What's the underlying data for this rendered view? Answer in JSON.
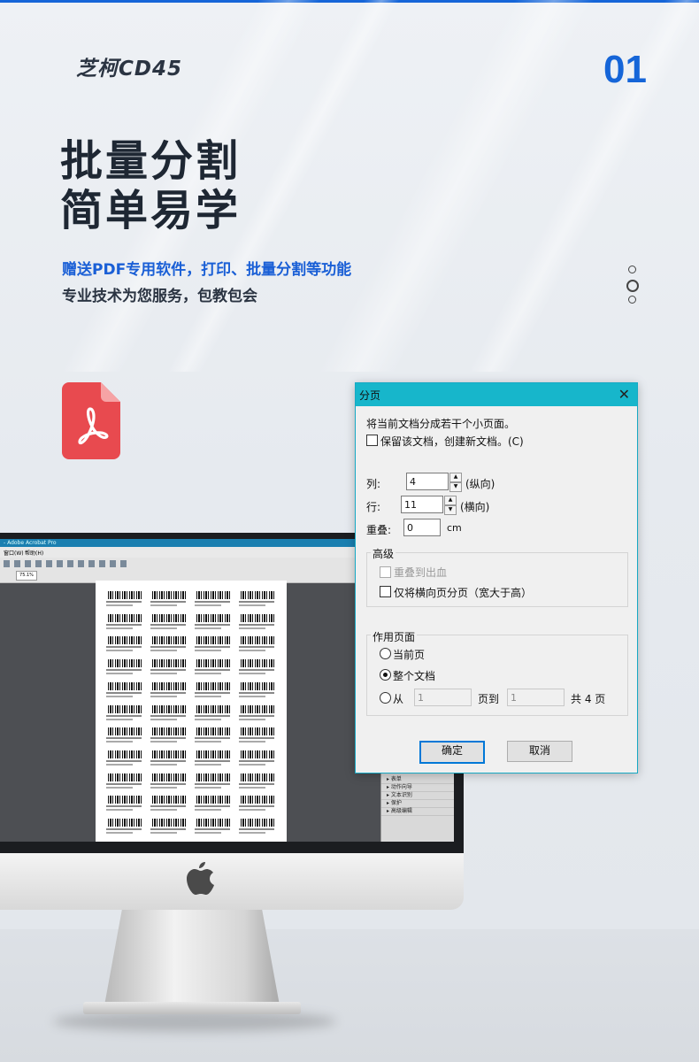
{
  "brand": "芝柯CD45",
  "page_number": "01",
  "headline": {
    "line1": "批量分割",
    "line2": "简单易学"
  },
  "subtitle": {
    "line1": "赠送PDF专用软件，打印、批量分割等功能",
    "line2": "专业技术为您服务，包教包会"
  },
  "pager": {
    "total": 3,
    "active_index": 1
  },
  "app_window": {
    "title": "- Adobe Acrobat Pro",
    "menu_items": [
      "窗口(W)",
      "帮助(H)"
    ],
    "zoom": "75.1%",
    "side_panel_items": [
      "表单",
      "动作向导",
      "文本识别",
      "保护",
      "高级编辑"
    ]
  },
  "dialog": {
    "title": "分页",
    "close_symbol": "✕",
    "description": "将当前文档分成若干个小页面。",
    "keep_doc_label": "保留该文档，创建新文档。(C)",
    "keep_doc_checked": false,
    "columns": {
      "label": "列:",
      "value": "4",
      "hint": "(纵向)"
    },
    "rows": {
      "label": "行:",
      "value": "11",
      "hint": "(横向)"
    },
    "overlap": {
      "label": "重叠:",
      "value": "0",
      "unit": "cm"
    },
    "spin_up": "▲",
    "spin_down": "▼",
    "advanced": {
      "title": "高级",
      "bleed_label": "重叠到出血",
      "bleed_checked": false,
      "bleed_disabled": true,
      "landscape_label": "仅将横向页分页（宽大于高）",
      "landscape_checked": false
    },
    "page_range": {
      "title": "作用页面",
      "current_label": "当前页",
      "whole_label": "整个文档",
      "selected": "whole",
      "from_label": "从",
      "from_value": "1",
      "to_label": "页到",
      "to_value": "1",
      "total_label": "共 4 页"
    },
    "ok_label": "确定",
    "cancel_label": "取消"
  },
  "colors": {
    "accent_blue": "#1565d8",
    "dialog_title_bar": "#17b6cb",
    "pdf_icon_red": "#e84a4f"
  }
}
